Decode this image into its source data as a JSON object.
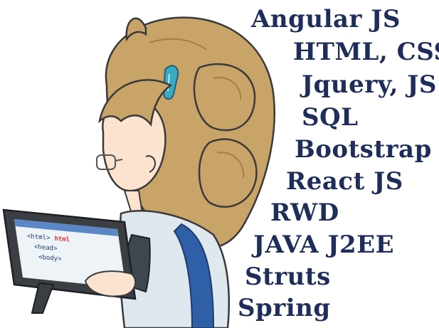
{
  "colors": {
    "skill_text": "#1f2d5a",
    "hair": "#c9a468",
    "hair_shadow": "#a27d45",
    "skin": "#fbe3cf",
    "outline": "#3a3a3a",
    "tablet_frame": "#3b3f44",
    "tablet_screen": "#eef3f8",
    "shirt_blue": "#2f5fa6",
    "hair_clip": "#3aa9c2"
  },
  "illustration": {
    "subject": "girl-with-tablet",
    "screen_lines": [
      "<html>",
      "<head>",
      "<body>"
    ],
    "screen_badge": "html"
  },
  "skills": [
    "Angular JS",
    "HTML, CSS",
    "Jquery, JS",
    "SQL",
    "Bootstrap",
    "React JS",
    "RWD",
    "JAVA J2EE",
    "Struts",
    "Spring"
  ]
}
